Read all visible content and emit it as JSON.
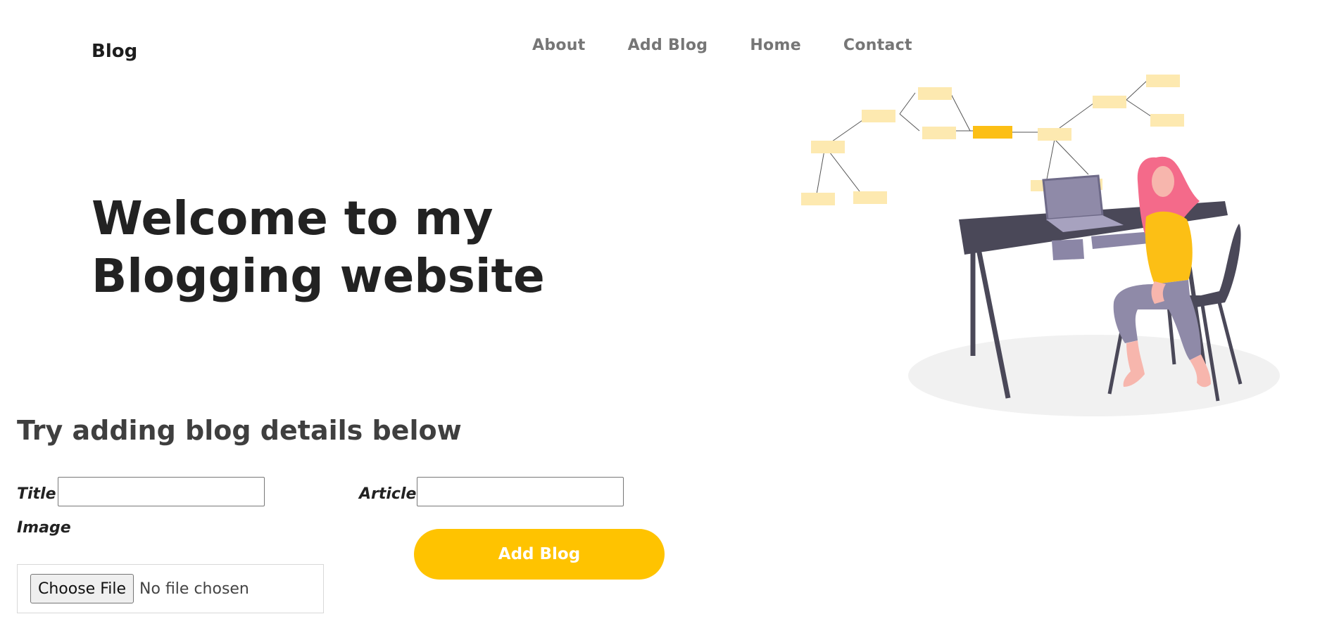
{
  "header": {
    "brand": "Blog",
    "nav": [
      {
        "label": "About"
      },
      {
        "label": "Add Blog"
      },
      {
        "label": "Home"
      },
      {
        "label": "Contact"
      }
    ]
  },
  "hero": {
    "title": "Welcome to my Blogging website",
    "illustration_icon": "woman-at-desk-illustration"
  },
  "form": {
    "heading": "Try adding blog details below",
    "title_label": "Title",
    "title_value": "",
    "article_label": "Article",
    "article_value": "",
    "image_label": "Image",
    "choose_file_label": "Choose File",
    "file_status": "No file chosen",
    "submit_label": "Add Blog"
  },
  "colors": {
    "accent": "#ffc300",
    "nav_text": "#767676",
    "heading_text": "#222222"
  }
}
